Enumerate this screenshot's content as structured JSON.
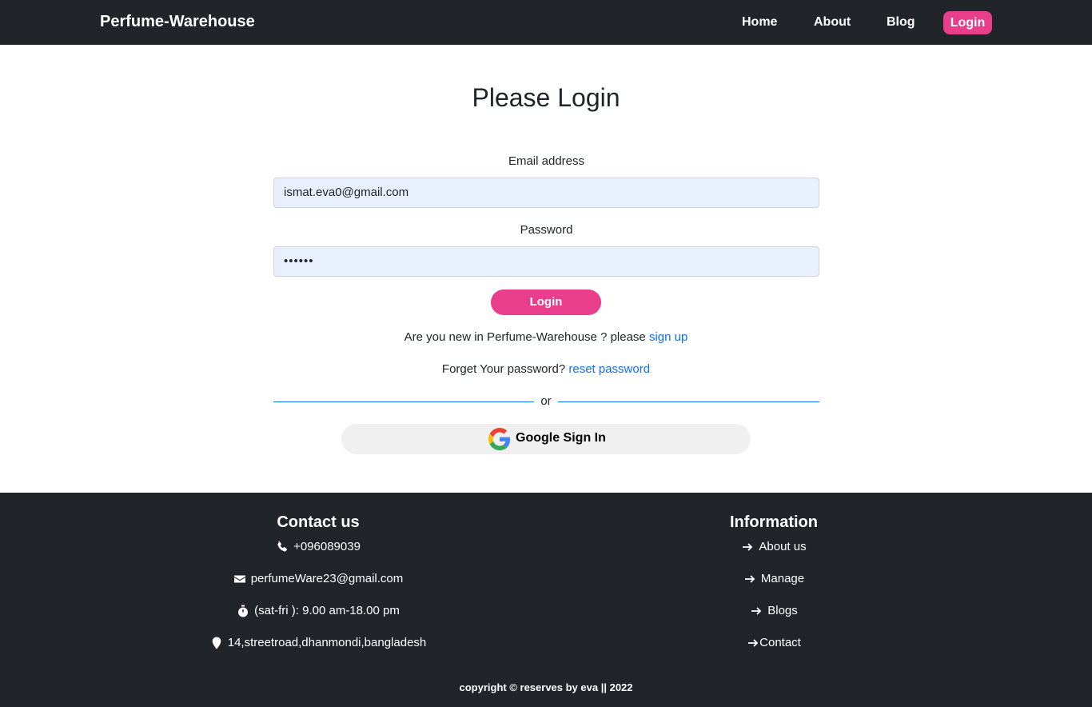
{
  "navbar": {
    "brand": "Perfume-Warehouse",
    "links": [
      "Home",
      "About",
      "Blog"
    ],
    "login": "Login",
    "colors": {
      "background": "#212529",
      "accent": "#e83e8c"
    }
  },
  "main": {
    "title": "Please Login",
    "email_label": "Email address",
    "email_value": "ismat.eva0@gmail.com",
    "password_label": "Password",
    "password_value": "••••••",
    "login_button": "Login",
    "new_user_text": "Are you new in Perfume-Warehouse ? please ",
    "signup_link": "sign up",
    "forget_text": "Forget Your password? ",
    "reset_link": "reset password",
    "or_text": "or",
    "google_button": "Google Sign In",
    "google_icon": "google-icon"
  },
  "footer": {
    "contact_title": "Contact us",
    "contact_items": [
      {
        "icon": "phone-icon",
        "text": "+096089039"
      },
      {
        "icon": "envelope-icon",
        "text": "perfumeWare23@gmail.com"
      },
      {
        "icon": "stopwatch-icon",
        "text": "(sat-fri ): 9.00 am-18.00 pm"
      },
      {
        "icon": "location-pin-icon",
        "text": "14,streetroad,dhanmondi,bangladesh"
      }
    ],
    "info_title": "Information",
    "info_items": [
      {
        "icon": "arrow-right-icon",
        "text": "About us"
      },
      {
        "icon": "arrow-right-icon",
        "text": "Manage"
      },
      {
        "icon": "arrow-right-icon",
        "text": "Blogs"
      },
      {
        "icon": "arrow-right-icon",
        "text": "Contact"
      }
    ],
    "copyright": "copyright © reserves by eva || 2022"
  }
}
